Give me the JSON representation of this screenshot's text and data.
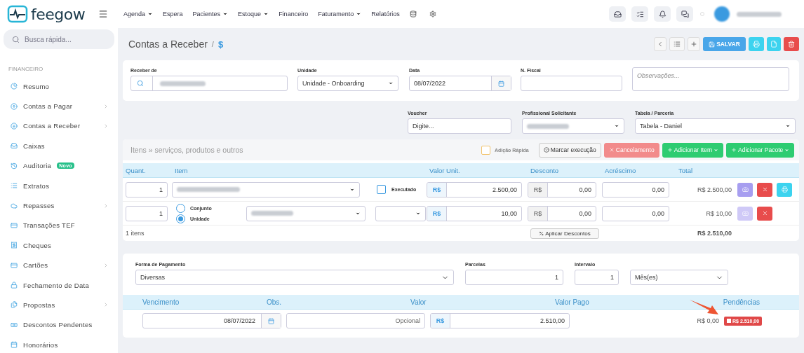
{
  "brand": "feegow",
  "nav": [
    {
      "label": "Agenda",
      "has_menu": true
    },
    {
      "label": "Espera",
      "has_menu": false
    },
    {
      "label": "Pacientes",
      "has_menu": true
    },
    {
      "label": "Estoque",
      "has_menu": true
    },
    {
      "label": "Financeiro",
      "has_menu": false
    },
    {
      "label": "Faturamento",
      "has_menu": true
    },
    {
      "label": "Relatórios",
      "has_menu": false
    }
  ],
  "search": {
    "placeholder": "Busca rápida..."
  },
  "sidebar": {
    "section": "FINANCEIRO",
    "items": [
      {
        "label": "Resumo",
        "has_children": false
      },
      {
        "label": "Contas a Pagar",
        "has_children": true
      },
      {
        "label": "Contas a Receber",
        "has_children": true
      },
      {
        "label": "Caixas",
        "has_children": false
      },
      {
        "label": "Auditoria",
        "has_children": false,
        "badge": "Novo"
      },
      {
        "label": "Extratos",
        "has_children": false
      },
      {
        "label": "Repasses",
        "has_children": true
      },
      {
        "label": "Transações TEF",
        "has_children": false
      },
      {
        "label": "Cheques",
        "has_children": false
      },
      {
        "label": "Cartões",
        "has_children": true
      },
      {
        "label": "Fechamento de Data",
        "has_children": false
      },
      {
        "label": "Propostas",
        "has_children": true
      },
      {
        "label": "Descontos Pendentes",
        "has_children": false
      },
      {
        "label": "Honorários",
        "has_children": false
      }
    ]
  },
  "breadcrumb": {
    "title": "Contas a Receber",
    "separator": "/",
    "current": "$"
  },
  "toolbar": {
    "save": "SALVAR"
  },
  "form": {
    "receber_de": {
      "label": "Receber de"
    },
    "unidade": {
      "label": "Unidade",
      "value": "Unidade - Onboarding"
    },
    "data": {
      "label": "Data",
      "value": "08/07/2022"
    },
    "n_fiscal": {
      "label": "N. Fiscal"
    },
    "observacoes": {
      "placeholder": "Observações..."
    },
    "voucher": {
      "label": "Voucher",
      "placeholder": "Digite..."
    },
    "profissional": {
      "label": "Profissional Solicitante"
    },
    "tabela": {
      "label": "Tabela / Parceria",
      "value": "Tabela - Daniel"
    }
  },
  "items": {
    "title": "Itens » serviços, produtos e outros",
    "quick_add": {
      "label": "Adição Rápida",
      "checked": false
    },
    "buttons": [
      {
        "label": "Marcar execução",
        "kind": "check"
      },
      {
        "label": "Cancelamento",
        "kind": "cancel"
      },
      {
        "label": "Adicionar Item",
        "kind": "add"
      },
      {
        "label": "Adicionar Pacote",
        "kind": "add"
      }
    ],
    "columns": [
      "Quant.",
      "Item",
      "Valor Unit.",
      "Desconto",
      "Acréscimo",
      "Total"
    ],
    "rows": [
      {
        "kind": "service",
        "qty": "1",
        "executed": {
          "label": "Executado",
          "checked": false
        },
        "unit_currency": "R$",
        "unit_value": "2.500,00",
        "discount_currency": "R$",
        "discount": "0,00",
        "surcharge": "0,00",
        "total": "R$ 2.500,00",
        "printable": true
      },
      {
        "kind": "product",
        "qty": "1",
        "options": [
          {
            "label": "Conjunto",
            "selected": false
          },
          {
            "label": "Unidade",
            "selected": true
          }
        ],
        "unit_currency": "R$",
        "unit_value": "10,00",
        "discount_currency": "R$",
        "discount": "0,00",
        "surcharge": "0,00",
        "total": "R$ 10,00",
        "printable": false
      }
    ],
    "count": "1 itens",
    "apply_discounts": "Aplicar Descontos",
    "grand_total": "R$ 2.510,00"
  },
  "payment": {
    "method": {
      "label": "Forma de Pagamento",
      "value": "Diversas"
    },
    "installments": {
      "label": "Parcelas",
      "value": "1"
    },
    "interval": {
      "label": "Intervalo",
      "value": "1"
    },
    "interval_unit": {
      "value": "Mês(es)"
    },
    "columns": [
      "Vencimento",
      "Obs.",
      "Valor",
      "Valor Pago",
      "Pendências"
    ],
    "rows": [
      {
        "due": "08/07/2022",
        "obs_placeholder": "Opcional",
        "currency": "R$",
        "value": "2.510,00",
        "paid": "R$ 0,00",
        "pending": "R$ 2.510,00"
      }
    ]
  }
}
